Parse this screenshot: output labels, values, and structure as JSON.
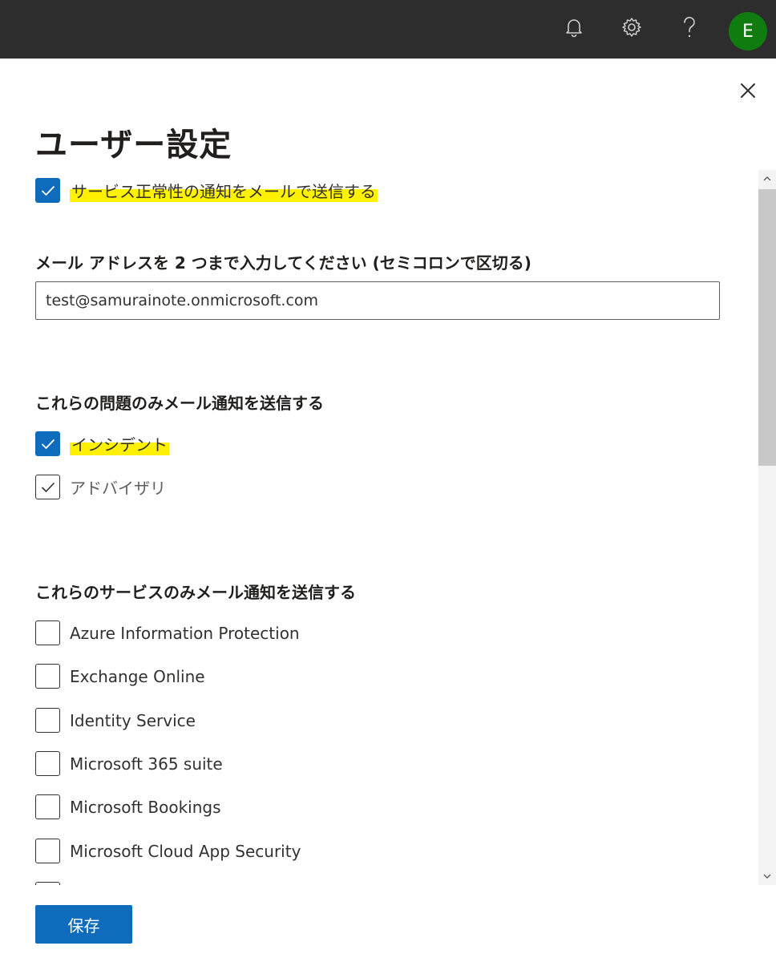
{
  "header": {
    "icons": [
      "bell-icon",
      "gear-icon",
      "help-icon"
    ],
    "avatar_initial": "E",
    "avatar_color": "#107c10"
  },
  "panel": {
    "title": "ユーザー設定",
    "close_icon": "close-icon",
    "service_health_checkbox": {
      "label": "サービス正常性の通知をメールで送信する",
      "checked": true
    },
    "email_section": {
      "label": "メール アドレスを 2 つまで入力してください (セミコロンで区切る)",
      "value": "test@samurainote.onmicrosoft.com"
    },
    "issues_section": {
      "label": "これらの問題のみメール通知を送信する",
      "options": [
        {
          "label": "インシデント",
          "checked": true
        },
        {
          "label": "アドバイザリ",
          "checked": true
        }
      ]
    },
    "services_section": {
      "label": "これらのサービスのみメール通知を送信する",
      "options": [
        {
          "label": "Azure Information Protection",
          "checked": false
        },
        {
          "label": "Exchange Online",
          "checked": false
        },
        {
          "label": "Identity Service",
          "checked": false
        },
        {
          "label": "Microsoft 365 suite",
          "checked": false
        },
        {
          "label": "Microsoft Bookings",
          "checked": false
        },
        {
          "label": "Microsoft Cloud App Security",
          "checked": false
        }
      ]
    },
    "save_label": "保存"
  },
  "colors": {
    "topbar": "#2d2d2d",
    "accent": "#0f6cbd",
    "highlight": "#fff100"
  }
}
